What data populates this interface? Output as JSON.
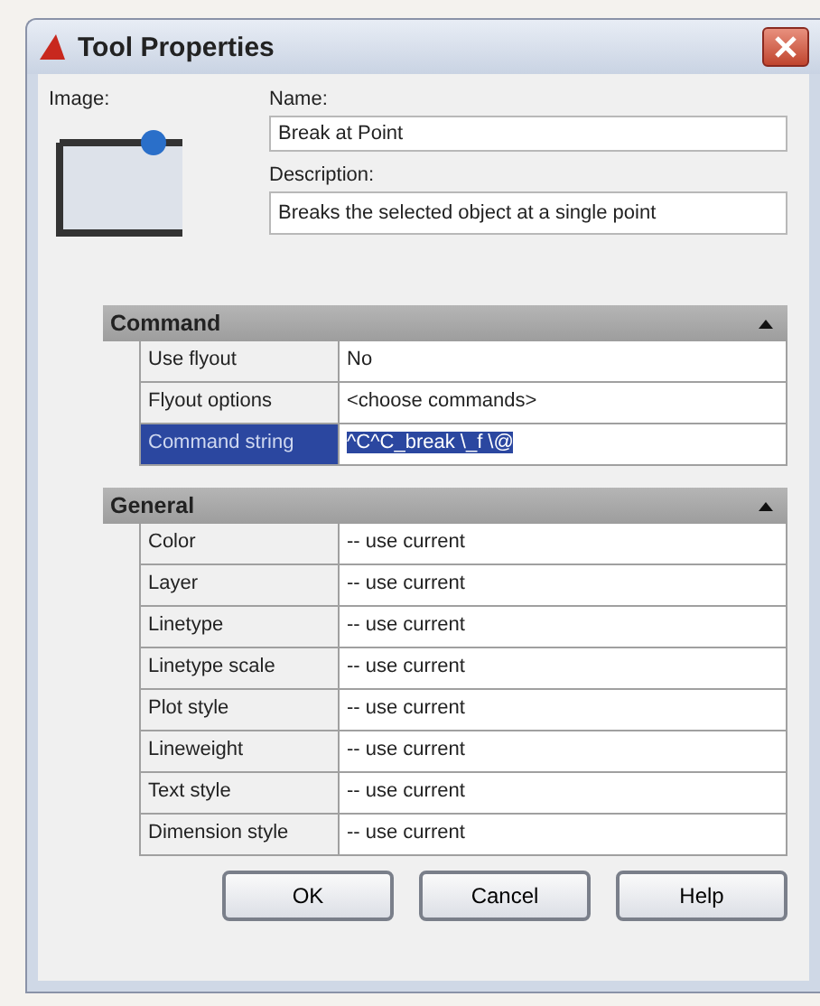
{
  "window": {
    "title": "Tool Properties"
  },
  "image_label": "Image:",
  "name": {
    "label": "Name:",
    "value": "Break at Point"
  },
  "description": {
    "label": "Description:",
    "value": "Breaks the selected object at a single point"
  },
  "sections": [
    {
      "title": "Command",
      "expanded": true,
      "rows": [
        {
          "label": "Use flyout",
          "value": "No",
          "selected": false
        },
        {
          "label": "Flyout options",
          "value": "<choose commands>",
          "selected": false
        },
        {
          "label": "Command string",
          "value": "^C^C_break \\_f \\@",
          "selected": true
        }
      ]
    },
    {
      "title": "General",
      "expanded": true,
      "rows": [
        {
          "label": "Color",
          "value": "-- use current",
          "selected": false
        },
        {
          "label": "Layer",
          "value": "-- use current",
          "selected": false
        },
        {
          "label": "Linetype",
          "value": "-- use current",
          "selected": false
        },
        {
          "label": "Linetype scale",
          "value": "-- use current",
          "selected": false
        },
        {
          "label": "Plot style",
          "value": "-- use current",
          "selected": false
        },
        {
          "label": "Lineweight",
          "value": "-- use current",
          "selected": false
        },
        {
          "label": "Text style",
          "value": "-- use current",
          "selected": false
        },
        {
          "label": "Dimension  style",
          "value": "-- use current",
          "selected": false
        }
      ]
    }
  ],
  "buttons": [
    "OK",
    "Cancel",
    "Help"
  ]
}
